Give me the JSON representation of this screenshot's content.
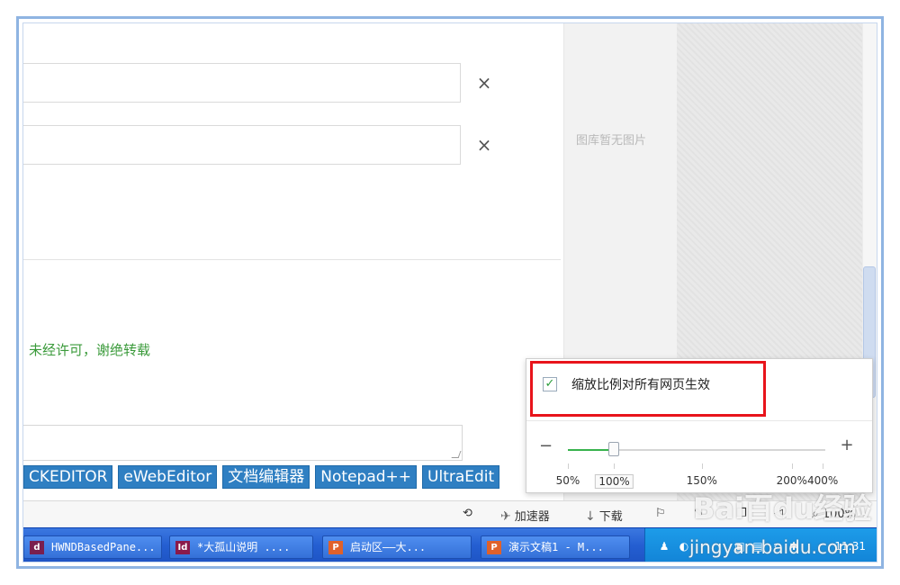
{
  "content": {
    "notice": "未经许可，谢绝转载",
    "tags": [
      "CKEDITOR",
      "eWebEditor",
      "文档编辑器",
      "Notepad++",
      "UltraEdit"
    ],
    "remove_icon": "close-icon"
  },
  "sidebar": {
    "gallery_empty": "图库暂无图片"
  },
  "zoom_popup": {
    "apply_all_label": "缩放比例对所有网页生效",
    "apply_all_checked": true,
    "slider_value_percent": 100,
    "minus": "−",
    "plus": "+",
    "options": [
      "50%",
      "100%",
      "150%",
      "200%",
      "400%"
    ],
    "selected": "100%",
    "highlight_color": "#e8141b"
  },
  "statusbar": {
    "accelerator": "加速器",
    "download": "下载",
    "zoom": "100%"
  },
  "taskbar": {
    "tasks": [
      {
        "icon": "d",
        "label": "HWNDBasedPane..."
      },
      {
        "icon": "Id",
        "label": "*大孤山说明 ...."
      },
      {
        "icon": "P",
        "label": "启动区——大..."
      },
      {
        "icon": "P",
        "label": "演示文稿1 - M..."
      }
    ],
    "clock": "11:31"
  },
  "watermark": {
    "brand": "Bai百du经验",
    "url": "jingyan.baidu.com"
  }
}
